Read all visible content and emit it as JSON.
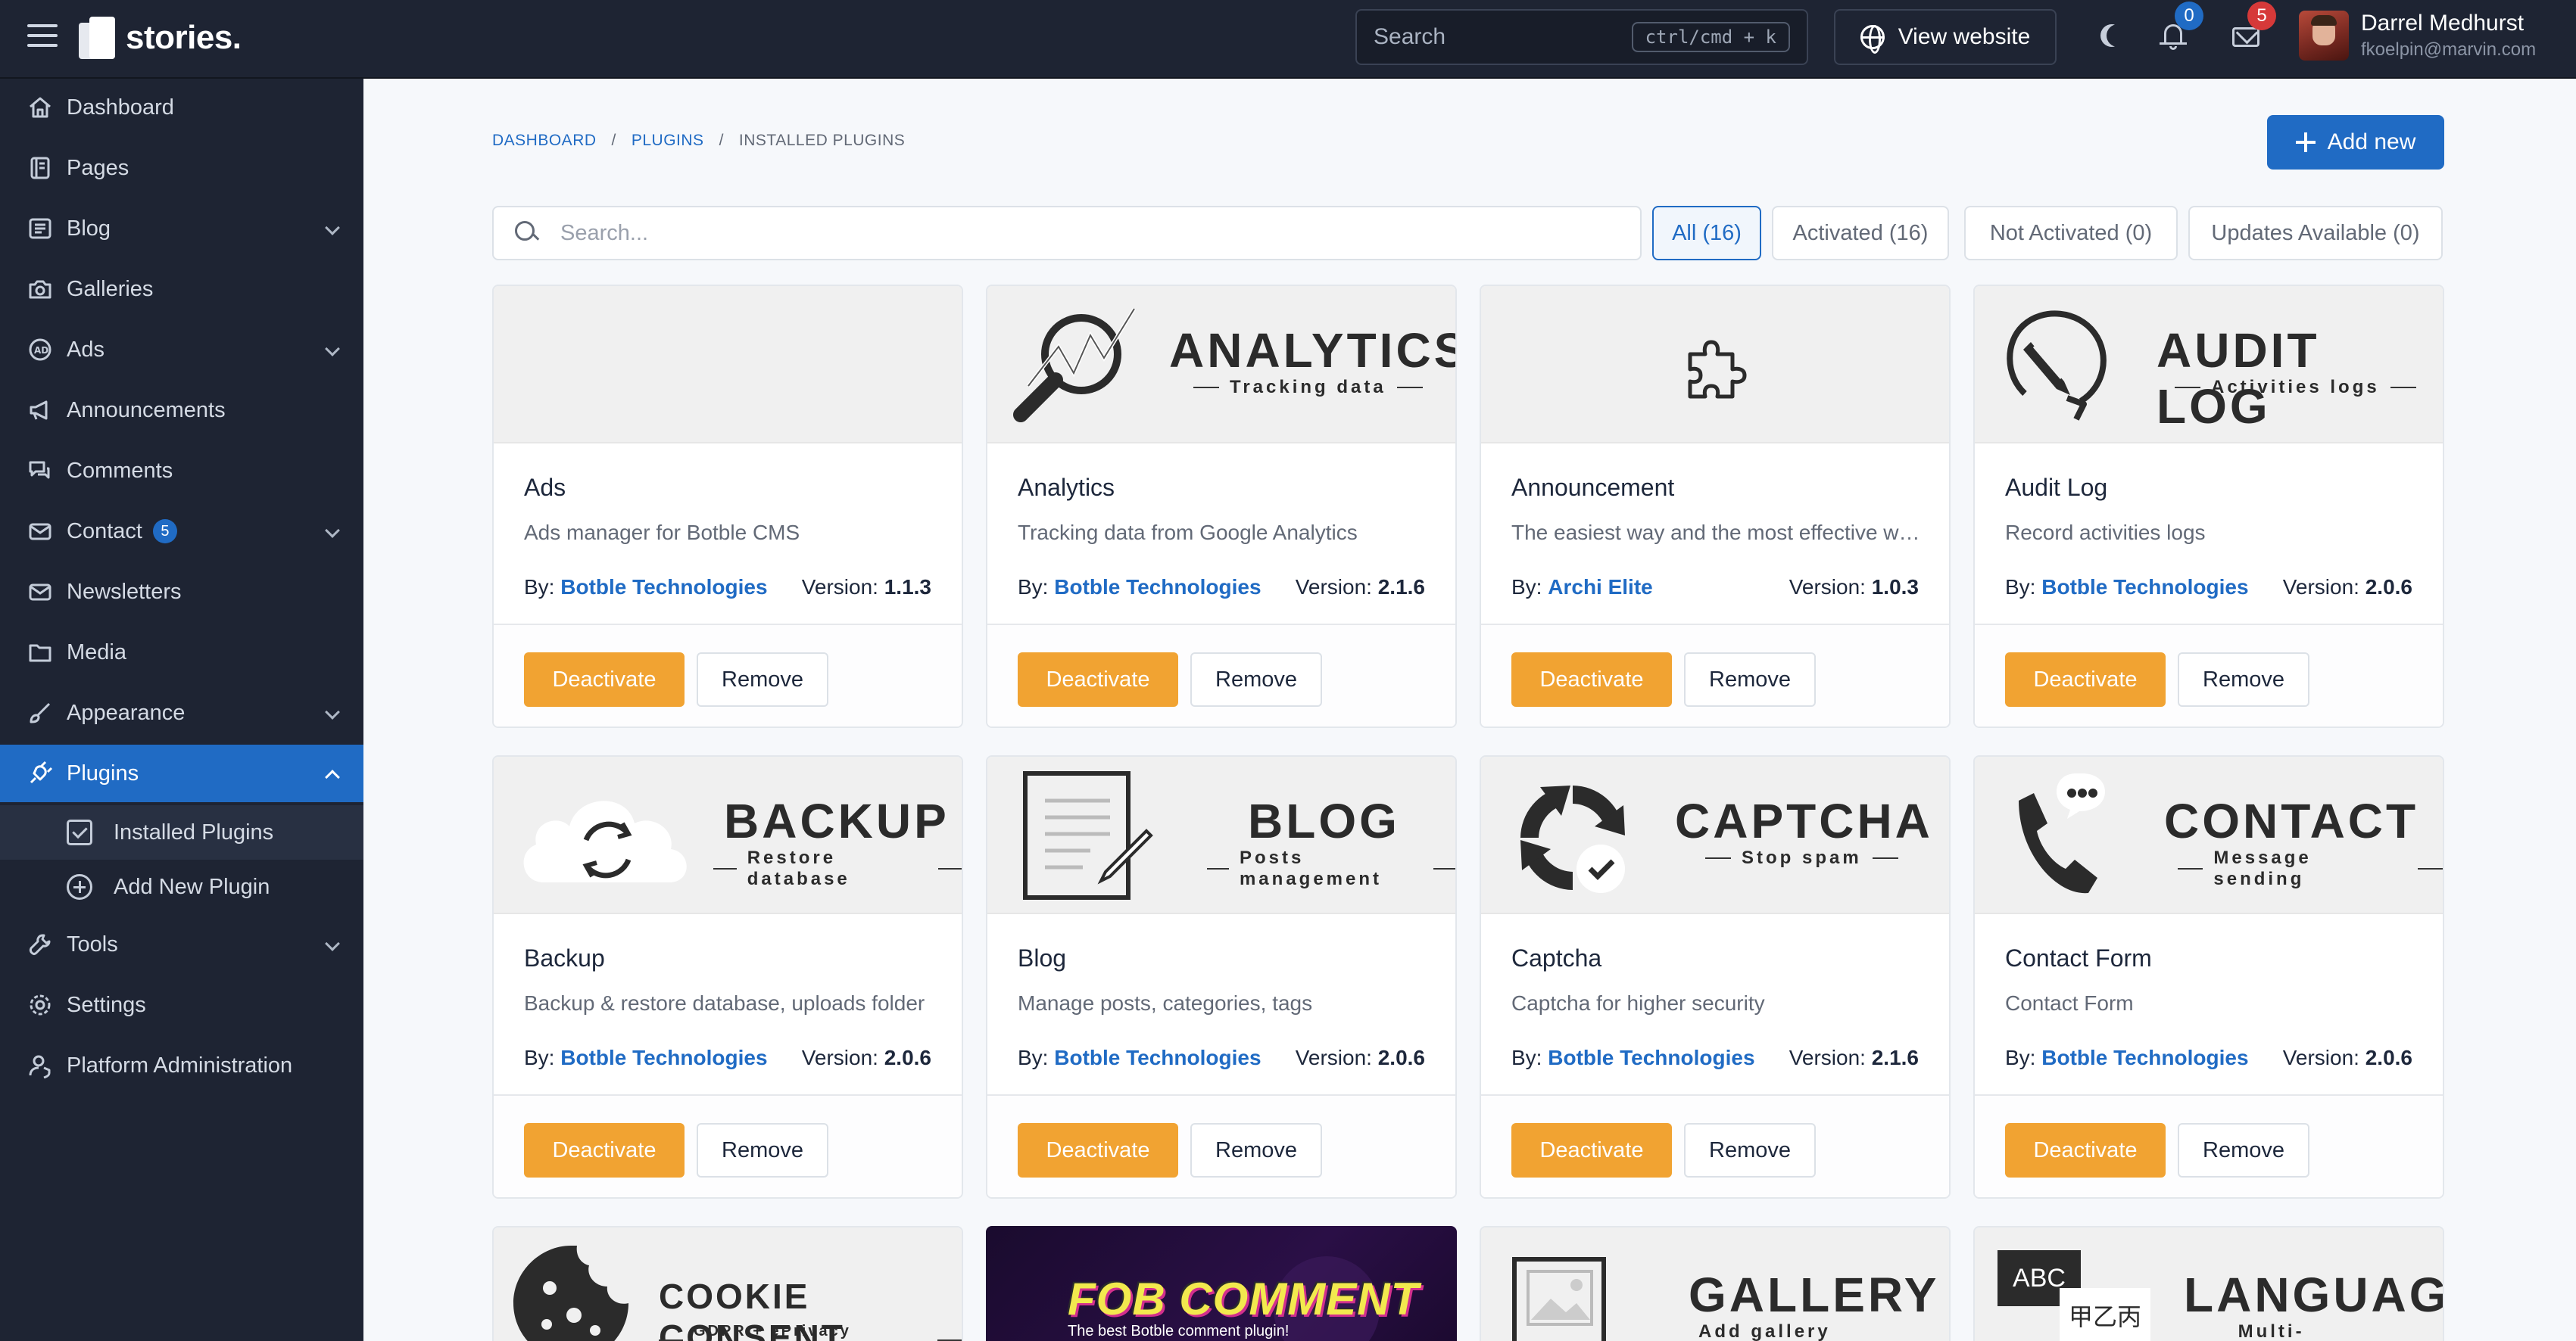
{
  "app": {
    "logo_text": "stories."
  },
  "topbar": {
    "search_placeholder": "Search",
    "search_shortcut": "ctrl/cmd + k",
    "view_website": "View website",
    "notifications_count": "0",
    "messages_count": "5",
    "user_name": "Darrel Medhurst",
    "user_email": "fkoelpin@marvin.com"
  },
  "sidebar": {
    "items": [
      {
        "label": "Dashboard",
        "icon": "home-icon"
      },
      {
        "label": "Pages",
        "icon": "book-icon"
      },
      {
        "label": "Blog",
        "icon": "article-icon",
        "expandable": true
      },
      {
        "label": "Galleries",
        "icon": "camera-icon"
      },
      {
        "label": "Ads",
        "icon": "ad-icon",
        "expandable": true
      },
      {
        "label": "Announcements",
        "icon": "speakerphone-icon"
      },
      {
        "label": "Comments",
        "icon": "comments-icon"
      },
      {
        "label": "Contact",
        "icon": "mail-icon",
        "badge": "5",
        "expandable": true
      },
      {
        "label": "Newsletters",
        "icon": "mail-opened-icon"
      },
      {
        "label": "Media",
        "icon": "folder-icon"
      },
      {
        "label": "Appearance",
        "icon": "brush-icon",
        "expandable": true
      },
      {
        "label": "Plugins",
        "icon": "plug-icon",
        "expandable": true,
        "active": true
      },
      {
        "label": "Tools",
        "icon": "tool-icon",
        "expandable": true
      },
      {
        "label": "Settings",
        "icon": "settings-icon"
      },
      {
        "label": "Platform Administration",
        "icon": "user-shield-icon"
      }
    ],
    "sub_items": [
      {
        "label": "Installed Plugins",
        "active": true
      },
      {
        "label": "Add New Plugin"
      }
    ]
  },
  "breadcrumb": [
    "DASHBOARD",
    "PLUGINS",
    "INSTALLED PLUGINS"
  ],
  "add_new_label": "Add new",
  "search_placeholder": "Search...",
  "filters": [
    {
      "label": "All (16)",
      "active": true
    },
    {
      "label": "Activated (16)"
    },
    {
      "label": "Not Activated (0)"
    },
    {
      "label": "Updates Available (0)"
    }
  ],
  "plugins": [
    {
      "name": "Ads",
      "description": "Ads manager for Botble CMS",
      "author": "Botble Technologies",
      "version": "1.1.3",
      "banner_title": "",
      "banner_sub": ""
    },
    {
      "name": "Analytics",
      "description": "Tracking data from Google Analytics",
      "author": "Botble Technologies",
      "version": "2.1.6",
      "banner_title": "ANALYTICS",
      "banner_sub": "Tracking data"
    },
    {
      "name": "Announcement",
      "description": "The easiest way and the most effective way to make announcements",
      "author": "Archi Elite",
      "version": "1.0.3",
      "banner_title": "",
      "banner_sub": ""
    },
    {
      "name": "Audit Log",
      "description": "Record activities logs",
      "author": "Botble Technologies",
      "version": "2.0.6",
      "banner_title": "AUDIT LOG",
      "banner_sub": "Activities logs"
    },
    {
      "name": "Backup",
      "description": "Backup & restore database, uploads folder",
      "author": "Botble Technologies",
      "version": "2.0.6",
      "banner_title": "BACKUP",
      "banner_sub": "Restore database"
    },
    {
      "name": "Blog",
      "description": "Manage posts, categories, tags",
      "author": "Botble Technologies",
      "version": "2.0.6",
      "banner_title": "BLOG",
      "banner_sub": "Posts management"
    },
    {
      "name": "Captcha",
      "description": "Captcha for higher security",
      "author": "Botble Technologies",
      "version": "2.1.6",
      "banner_title": "CAPTCHA",
      "banner_sub": "Stop spam"
    },
    {
      "name": "Contact Form",
      "description": "Contact Form",
      "author": "Botble Technologies",
      "version": "2.0.6",
      "banner_title": "CONTACT",
      "banner_sub": "Message sending"
    },
    {
      "banner_title": "COOKIE CONSENT",
      "banner_sub": "GDPR + ePrivacy Directive"
    },
    {
      "banner_title": "FOB COMMENT",
      "banner_sub": "The best Botble comment plugin!"
    },
    {
      "banner_title": "GALLERY",
      "banner_sub": "Add gallery images"
    },
    {
      "banner_title": "LANGUAGE",
      "banner_sub": "Multi-language",
      "banner_extra_1": "ABC",
      "banner_extra_2": "甲乙丙"
    }
  ],
  "labels": {
    "by": "By:",
    "version": "Version:",
    "deactivate": "Deactivate",
    "remove": "Remove"
  },
  "colors": {
    "primary": "#206bc4",
    "deactivate": "#f1a332",
    "sidebar": "#1e2433",
    "danger": "#d63939"
  }
}
